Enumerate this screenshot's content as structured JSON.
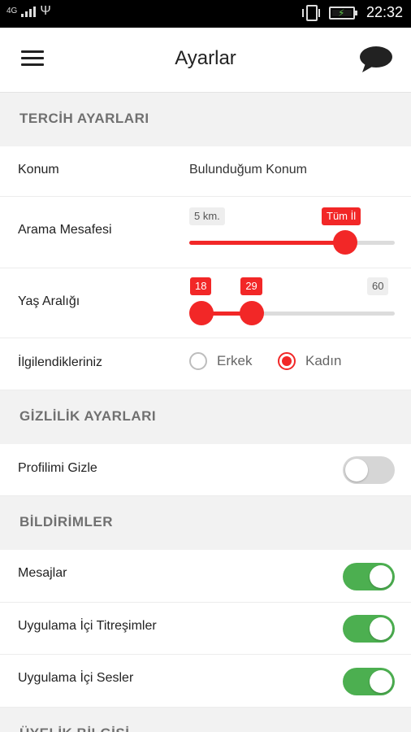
{
  "status_bar": {
    "network": "4G",
    "time": "22:32"
  },
  "app_bar": {
    "title": "Ayarlar",
    "menu_icon": "hamburger-menu-icon",
    "chat_icon": "chat-bubble-icon"
  },
  "sections": {
    "preferences": {
      "title": "TERCİH AYARLARI"
    },
    "privacy": {
      "title": "GİZLİLİK AYARLARI"
    },
    "notifications": {
      "title": "BİLDİRİMLER"
    },
    "membership": {
      "title": "ÜYELİK BİLGİSİ"
    }
  },
  "location": {
    "label": "Konum",
    "value": "Bulunduğum Konum"
  },
  "search_distance": {
    "label": "Arama Mesafesi",
    "min_label": "5 km.",
    "current_label": "Tüm İl",
    "value_fraction": 0.76
  },
  "age_range": {
    "label": "Yaş Aralığı",
    "low_label": "18",
    "high_label": "29",
    "max_label": "60",
    "low": 18,
    "high": 29,
    "min": 18,
    "max": 60
  },
  "interests": {
    "label": "İlgilendikleriniz",
    "option_male": "Erkek",
    "option_female": "Kadın",
    "selected": "Kadın"
  },
  "hide_profile": {
    "label": "Profilimi Gizle",
    "enabled": false
  },
  "messages": {
    "label": "Mesajlar",
    "enabled": true
  },
  "in_app_vibration": {
    "label": "Uygulama İçi Titreşimler",
    "enabled": true
  },
  "in_app_sounds": {
    "label": "Uygulama İçi Sesler",
    "enabled": true
  },
  "colors": {
    "accent": "#f22727",
    "toggle_on": "#4caf50",
    "toggle_off": "#d6d6d6",
    "section_bg": "#f2f2f2"
  }
}
